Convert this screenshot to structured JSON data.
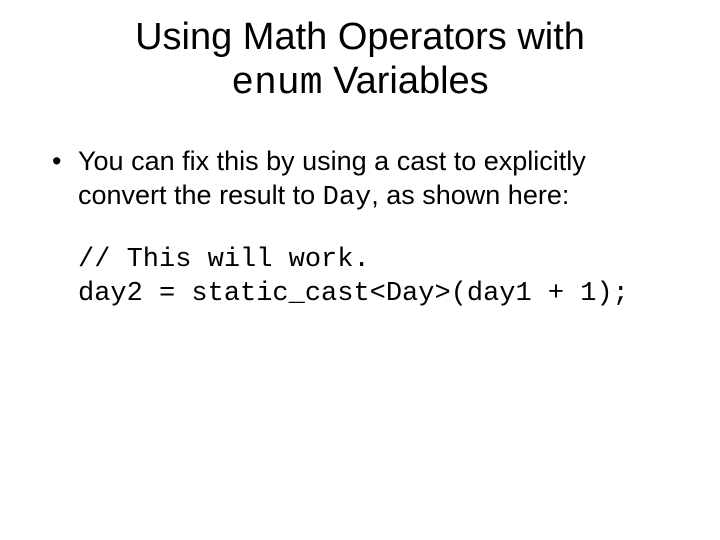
{
  "title": {
    "line1_pre": "Using Math Operators with",
    "line2_code": "enum",
    "line2_post": " Variables"
  },
  "bullet": {
    "text_pre": "You can fix this by using a cast to explicitly convert the result to ",
    "code": "Day",
    "text_post": ", as shown here:"
  },
  "code": {
    "line1": "// This will work.",
    "line2": "day2 = static_cast<Day>(day1 + 1);"
  }
}
